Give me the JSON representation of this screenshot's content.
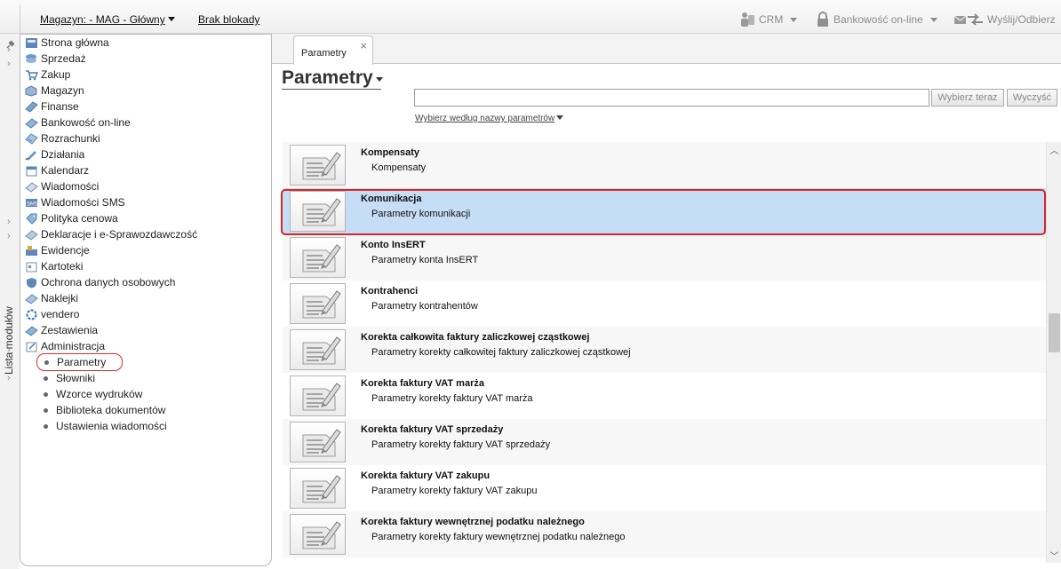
{
  "topbar": {
    "warehouse": "Magazyn: - MAG - Główny",
    "lock": "Brak blokady",
    "crm": "CRM",
    "banking": "Bankowość on-line",
    "send": "Wyślij/Odbierz"
  },
  "side_strip": {
    "label": "Lista modułów"
  },
  "modules": {
    "items": [
      {
        "label": "Strona główna",
        "icon": "home-icon"
      },
      {
        "label": "Sprzedaż",
        "icon": "sales-icon"
      },
      {
        "label": "Zakup",
        "icon": "cart-icon"
      },
      {
        "label": "Magazyn",
        "icon": "warehouse-icon"
      },
      {
        "label": "Finanse",
        "icon": "finance-icon"
      },
      {
        "label": "Bankowość on-line",
        "icon": "bank-icon"
      },
      {
        "label": "Rozrachunki",
        "icon": "settlement-icon"
      },
      {
        "label": "Działania",
        "icon": "actions-icon"
      },
      {
        "label": "Kalendarz",
        "icon": "calendar-icon"
      },
      {
        "label": "Wiadomości",
        "icon": "messages-icon"
      },
      {
        "label": "Wiadomości SMS",
        "icon": "sms-icon"
      },
      {
        "label": "Polityka cenowa",
        "icon": "pricing-icon"
      },
      {
        "label": "Deklaracje i e-Sprawozdawczość",
        "icon": "declarations-icon"
      },
      {
        "label": "Ewidencje",
        "icon": "records-icon"
      },
      {
        "label": "Kartoteki",
        "icon": "files-icon"
      },
      {
        "label": "Ochrona danych osobowych",
        "icon": "shield-icon"
      },
      {
        "label": "Naklejki",
        "icon": "labels-icon"
      },
      {
        "label": "vendero",
        "icon": "vendero-icon"
      },
      {
        "label": "Zestawienia",
        "icon": "reports-icon"
      },
      {
        "label": "Administracja",
        "icon": "admin-icon"
      }
    ],
    "subitems": [
      "Parametry",
      "Słowniki",
      "Wzorce wydruków",
      "Biblioteka dokumentów",
      "Ustawienia wiadomości"
    ]
  },
  "tab": {
    "label": "Parametry",
    "close": "×"
  },
  "page": {
    "title": "Parametry",
    "search_value": "",
    "choose_btn": "Wybierz teraz",
    "clear_btn": "Wyczyść",
    "filter_link": "Wybierz według nazwy parametrów"
  },
  "list": [
    {
      "title": "Kompensaty",
      "desc": "Kompensaty"
    },
    {
      "title": "Komunikacja",
      "desc": "Parametry komunikacji"
    },
    {
      "title": "Konto InsERT",
      "desc": "Parametry konta InsERT"
    },
    {
      "title": "Kontrahenci",
      "desc": "Parametry kontrahentów"
    },
    {
      "title": "Korekta całkowita faktury zaliczkowej cząstkowej",
      "desc": "Parametry korekty całkowitej faktury zaliczkowej cząstkowej"
    },
    {
      "title": "Korekta faktury VAT marża",
      "desc": "Parametry korekty faktury VAT marża"
    },
    {
      "title": "Korekta faktury VAT sprzedaży",
      "desc": "Parametry korekty faktury VAT sprzedaży"
    },
    {
      "title": "Korekta faktury VAT zakupu",
      "desc": "Parametry korekty faktury VAT zakupu"
    },
    {
      "title": "Korekta faktury wewnętrznej podatku należnego",
      "desc": "Parametry korekty faktury wewnętrznej podatku należnego"
    }
  ],
  "selected_index": 1
}
